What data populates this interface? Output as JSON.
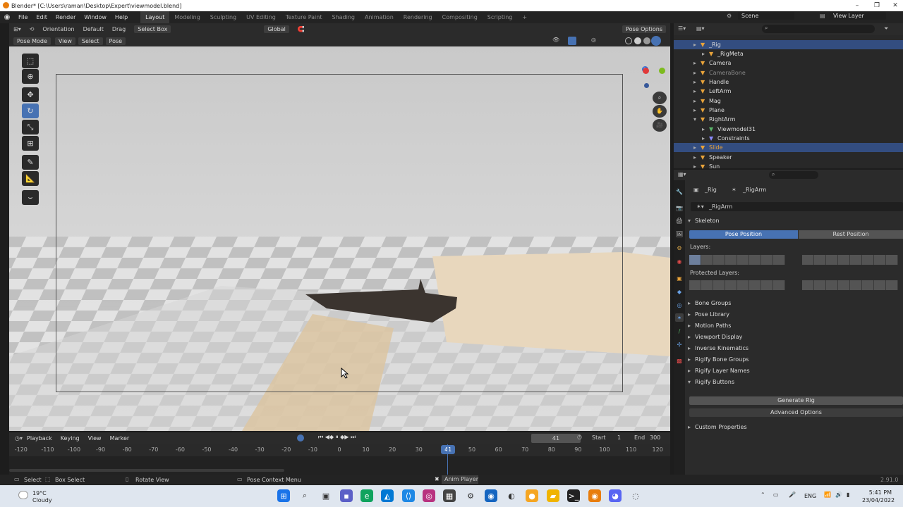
{
  "window": {
    "title": "Blender* [C:\\Users\\raman\\Desktop\\Expert\\viewmodel.blend]"
  },
  "menu": [
    "File",
    "Edit",
    "Render",
    "Window",
    "Help"
  ],
  "workspaces": [
    "Layout",
    "Modeling",
    "Sculpting",
    "UV Editing",
    "Texture Paint",
    "Shading",
    "Animation",
    "Rendering",
    "Compositing",
    "Scripting"
  ],
  "workspace_add": "+",
  "scene": {
    "name": "Scene",
    "view_layer": "View Layer"
  },
  "header": {
    "orientation": "Orientation",
    "transform_orientation": "Default",
    "drag": "Drag",
    "select_box": "Select Box",
    "global": "Global",
    "pose_options": "Pose Options"
  },
  "mode": {
    "mode": "Pose Mode",
    "view": "View",
    "select": "Select",
    "pose": "Pose"
  },
  "outliner": {
    "items": [
      {
        "label": "_Rig",
        "indent": 0,
        "sel": true,
        "color": "#e8a33a"
      },
      {
        "label": "_RigMeta",
        "indent": 1,
        "sel": false,
        "color": "#e8a33a"
      },
      {
        "label": "Camera",
        "indent": 0,
        "sel": false,
        "color": "#e8a33a"
      },
      {
        "label": "CameraBone",
        "indent": 0,
        "sel": false,
        "color": "#e8a33a"
      },
      {
        "label": "Handle",
        "indent": 0,
        "sel": false,
        "color": "#e8a33a"
      },
      {
        "label": "LeftArm",
        "indent": 0,
        "sel": false,
        "color": "#e8a33a"
      },
      {
        "label": "Mag",
        "indent": 0,
        "sel": false,
        "color": "#e8a33a"
      },
      {
        "label": "Plane",
        "indent": 0,
        "sel": false,
        "color": "#e8a33a"
      },
      {
        "label": "RightArm",
        "indent": 0,
        "sel": false,
        "color": "#e8a33a"
      },
      {
        "label": "Viewmodel31",
        "indent": 1,
        "sel": false,
        "color": "#5ab56a"
      },
      {
        "label": "Constraints",
        "indent": 1,
        "sel": false,
        "color": "#8a8aff"
      },
      {
        "label": "Slide",
        "indent": 0,
        "sel": true,
        "color": "#e8a33a"
      },
      {
        "label": "Speaker",
        "indent": 0,
        "sel": false,
        "color": "#e8a33a"
      },
      {
        "label": "Sun",
        "indent": 0,
        "sel": false,
        "color": "#e8a33a"
      }
    ]
  },
  "properties": {
    "breadcrumb_object": "_Rig",
    "breadcrumb_data": "_RigArm",
    "data_name": "_RigArm",
    "skeleton": "Skeleton",
    "pose_position": "Pose Position",
    "rest_position": "Rest Position",
    "layers": "Layers:",
    "protected_layers": "Protected Layers:",
    "panels": [
      "Bone Groups",
      "Pose Library",
      "Motion Paths",
      "Viewport Display",
      "Inverse Kinematics",
      "Rigify Bone Groups",
      "Rigify Layer Names"
    ],
    "rigify_buttons": "Rigify Buttons",
    "generate_rig": "Generate Rig",
    "advanced_options": "Advanced Options",
    "custom_properties": "Custom Properties"
  },
  "timeline": {
    "playback": "Playback",
    "keying": "Keying",
    "view": "View",
    "marker": "Marker",
    "current_frame": "41",
    "start_label": "Start",
    "start": "1",
    "end_label": "End",
    "end": "300",
    "ticks": [
      "-120",
      "-110",
      "-100",
      "-90",
      "-80",
      "-70",
      "-60",
      "-50",
      "-40",
      "-30",
      "-20",
      "-10",
      "0",
      "10",
      "20",
      "30",
      "41",
      "50",
      "60",
      "70",
      "80",
      "90",
      "100",
      "110",
      "120"
    ]
  },
  "status": {
    "select": "Select",
    "box_select": "Box Select",
    "rotate_view": "Rotate View",
    "pose_context_menu": "Pose Context Menu",
    "anim_player": "Anim Player",
    "version": "2.91.0"
  },
  "taskbar": {
    "temp": "19°C",
    "weather": "Cloudy",
    "lang": "ENG",
    "time": "5:41 PM",
    "date": "23/04/2022"
  }
}
